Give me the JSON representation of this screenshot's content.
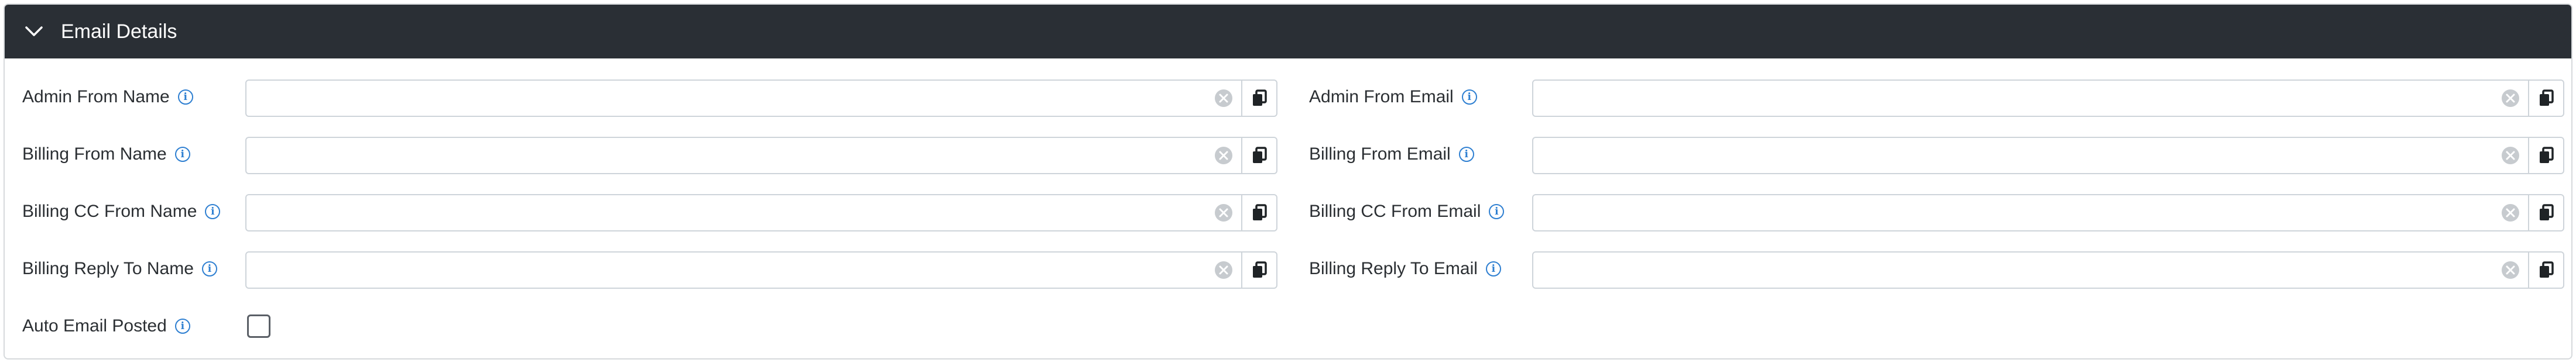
{
  "section": {
    "title": "Email Details"
  },
  "fields": [
    {
      "left": {
        "label": "Admin From Name",
        "value": ""
      },
      "right": {
        "label": "Admin From Email",
        "value": ""
      }
    },
    {
      "left": {
        "label": "Billing From Name",
        "value": ""
      },
      "right": {
        "label": "Billing From Email",
        "value": ""
      }
    },
    {
      "left": {
        "label": "Billing CC From Name",
        "value": ""
      },
      "right": {
        "label": "Billing CC From Email",
        "value": ""
      }
    },
    {
      "left": {
        "label": "Billing Reply To Name",
        "value": ""
      },
      "right": {
        "label": "Billing Reply To Email",
        "value": ""
      }
    }
  ],
  "auto_email_posted": {
    "label": "Auto Email Posted",
    "checked": false
  },
  "icons": {
    "collapse": "chevron-down-icon",
    "info": "info-icon",
    "clear": "clear-icon",
    "copy": "copy-icon"
  },
  "colors": {
    "header_bg": "#2a2f35",
    "info_blue": "#2e7fd1",
    "border": "#ced4da"
  }
}
